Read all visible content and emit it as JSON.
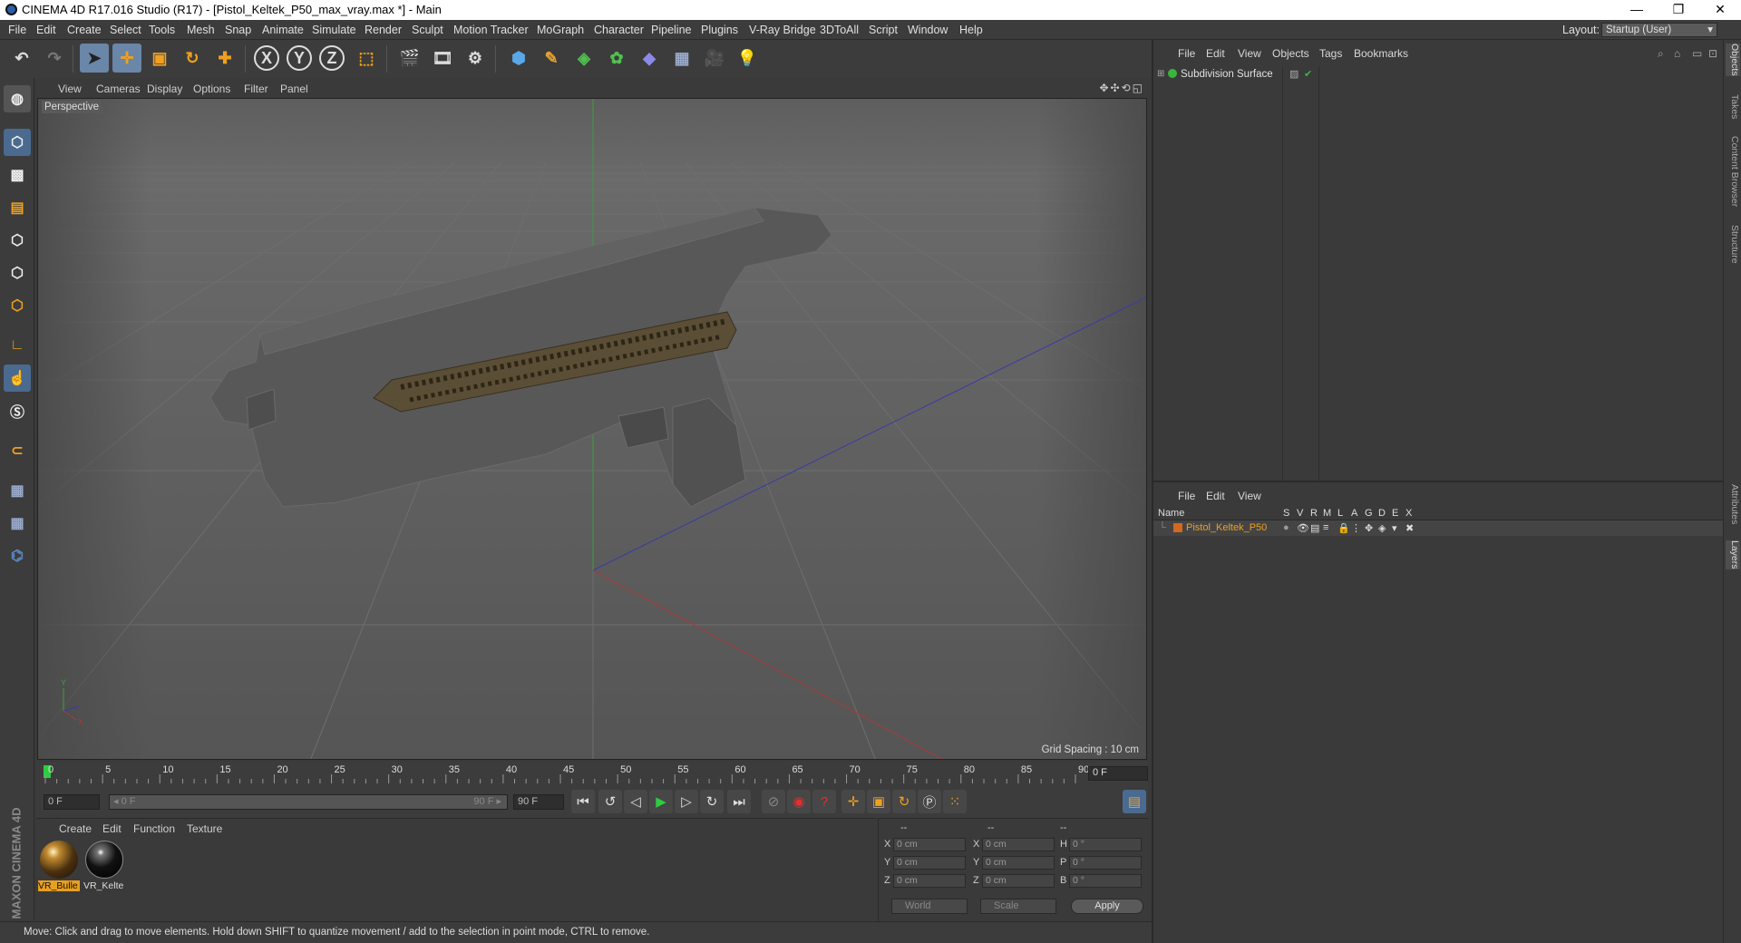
{
  "window": {
    "title": "CINEMA 4D R17.016 Studio (R17) - [Pistol_Keltek_P50_max_vray.max *] - Main",
    "min": "—",
    "max": "❐",
    "close": "✕"
  },
  "menubar": {
    "items": [
      "File",
      "Edit",
      "Create",
      "Select",
      "Tools",
      "Mesh",
      "Snap",
      "Animate",
      "Simulate",
      "Render",
      "Sculpt",
      "Motion Tracker",
      "MoGraph",
      "Character",
      "Pipeline",
      "Plugins",
      "V-Ray Bridge",
      "3DToAll",
      "Script",
      "Window",
      "Help"
    ],
    "layout_label": "Layout:",
    "layout_value": "Startup (User)"
  },
  "toolbar": {
    "icons": [
      "undo-icon",
      "redo-icon",
      "select-arrow-icon",
      "move-icon",
      "scale-icon",
      "rotate-icon",
      "live-select-icon",
      "x-axis-icon",
      "y-axis-icon",
      "z-axis-icon",
      "coordinate-system-icon",
      "render-view-icon",
      "render-picture-icon",
      "edit-render-settings-icon",
      "cube-icon",
      "pen-icon",
      "subdivision-icon",
      "cloner-icon",
      "deformer-icon",
      "floor-icon",
      "camera-icon",
      "light-icon"
    ],
    "axis_x": "X",
    "axis_y": "Y",
    "axis_z": "Z"
  },
  "viewport": {
    "menu": [
      "View",
      "Cameras",
      "Display",
      "Options",
      "Filter",
      "Panel"
    ],
    "label": "Perspective",
    "grid_spacing": "Grid Spacing : 10 cm",
    "nav_icons": "✥✣⟲◱"
  },
  "timeline": {
    "ticks": [
      "0",
      "5",
      "10",
      "15",
      "20",
      "25",
      "30",
      "35",
      "40",
      "45",
      "50",
      "55",
      "60",
      "65",
      "70",
      "75",
      "80",
      "85",
      "90"
    ],
    "current_frame": "0 F"
  },
  "transport": {
    "start_field": "0 F",
    "range_start": "◂ 0 F",
    "range_end": "90 F ▸",
    "end_field": "90 F"
  },
  "materials": {
    "menu": [
      "Create",
      "Edit",
      "Function",
      "Texture"
    ],
    "items": [
      {
        "label": "VR_Bulle",
        "color": "#e8a020"
      },
      {
        "label": "VR_Kelte",
        "color": "#cccccc"
      }
    ]
  },
  "coordinates": {
    "headers": [
      "--",
      "--",
      "--"
    ],
    "rows": [
      {
        "axis": "X",
        "pos": "0 cm",
        "axis2": "X",
        "size": "0 cm",
        "axis3": "H",
        "rot": "0 °"
      },
      {
        "axis": "Y",
        "pos": "0 cm",
        "axis2": "Y",
        "size": "0 cm",
        "axis3": "P",
        "rot": "0 °"
      },
      {
        "axis": "Z",
        "pos": "0 cm",
        "axis2": "Z",
        "size": "0 cm",
        "axis3": "B",
        "rot": "0 °"
      }
    ],
    "mode1": "World",
    "mode2": "Scale",
    "apply": "Apply"
  },
  "branding": "MAXON CINEMA 4D",
  "status": "Move: Click and drag to move elements. Hold down SHIFT to quantize movement / add to the selection in point mode, CTRL to remove.",
  "objects": {
    "menu": [
      "File",
      "Edit",
      "View",
      "Objects",
      "Tags",
      "Bookmarks"
    ],
    "root": "Subdivision Surface"
  },
  "layers": {
    "menu": [
      "File",
      "Edit",
      "View"
    ],
    "headers": [
      "Name",
      "S",
      "V",
      "R",
      "M",
      "L",
      "A",
      "G",
      "D",
      "E",
      "X"
    ],
    "row_name": "Pistol_Keltek_P50",
    "row_color": "#d2691e"
  },
  "sidetabs": [
    "Objects",
    "Takes",
    "Content Browser",
    "Structure",
    "Attributes",
    "Layers"
  ]
}
